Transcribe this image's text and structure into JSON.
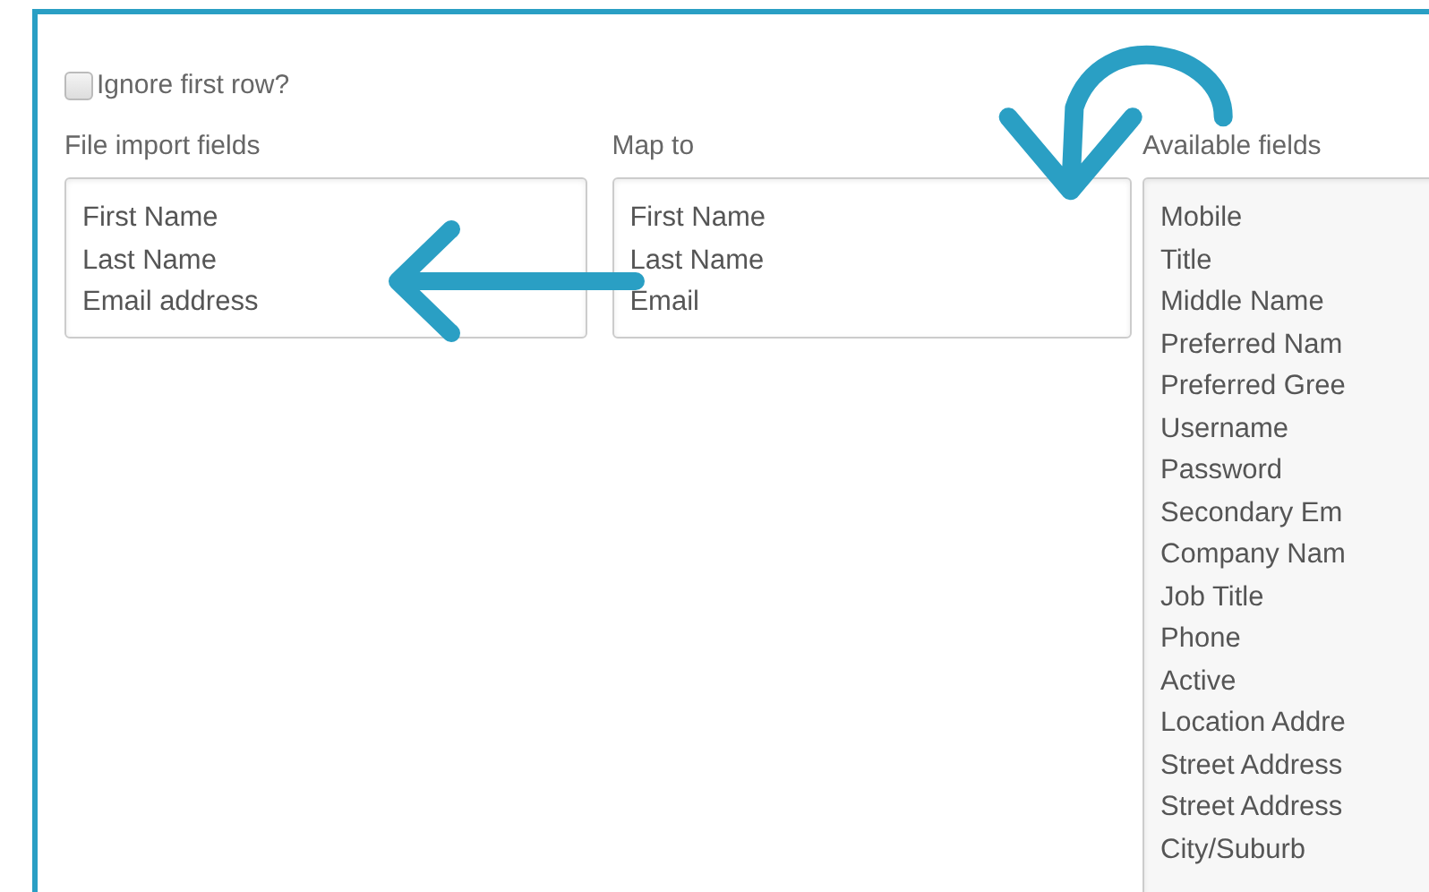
{
  "ignore_first_row": {
    "label": "Ignore first row?",
    "checked": false
  },
  "columns": [
    {
      "title": "File import fields",
      "items": [
        "First Name",
        "Last Name",
        "Email address"
      ],
      "kind": "short"
    },
    {
      "title": "Map to",
      "items": [
        "First Name",
        "Last Name",
        "Email"
      ],
      "kind": "short"
    },
    {
      "title": "Available fields",
      "items": [
        "Mobile",
        "Title",
        "Middle Name",
        "Preferred Nam",
        "Preferred Gree",
        "Username",
        "Password",
        "Secondary Em",
        "Company Nam",
        "Job Title",
        "Phone",
        "Active",
        "Location Addre",
        "Street Address",
        "Street Address",
        "City/Suburb"
      ],
      "kind": "tall"
    }
  ]
}
